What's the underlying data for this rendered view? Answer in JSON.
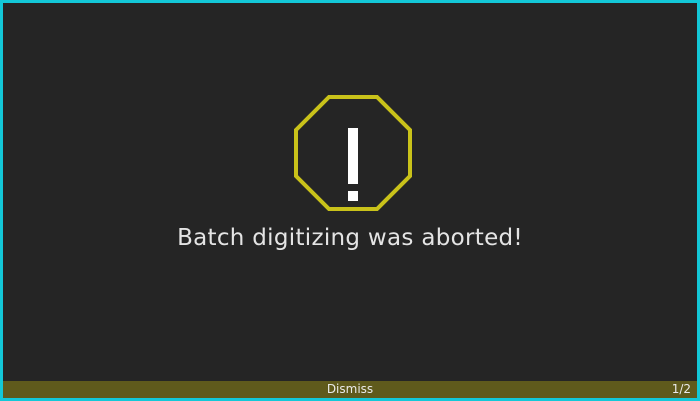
{
  "alert": {
    "icon": "warning-octagon-icon",
    "accent_color": "#c9c21a",
    "message": "Batch digitizing was aborted!"
  },
  "footer": {
    "dismiss_label": "Dismiss",
    "pager": "1/2",
    "bar_color": "#5f5a1c"
  },
  "window": {
    "border_color": "#13c8d8"
  }
}
